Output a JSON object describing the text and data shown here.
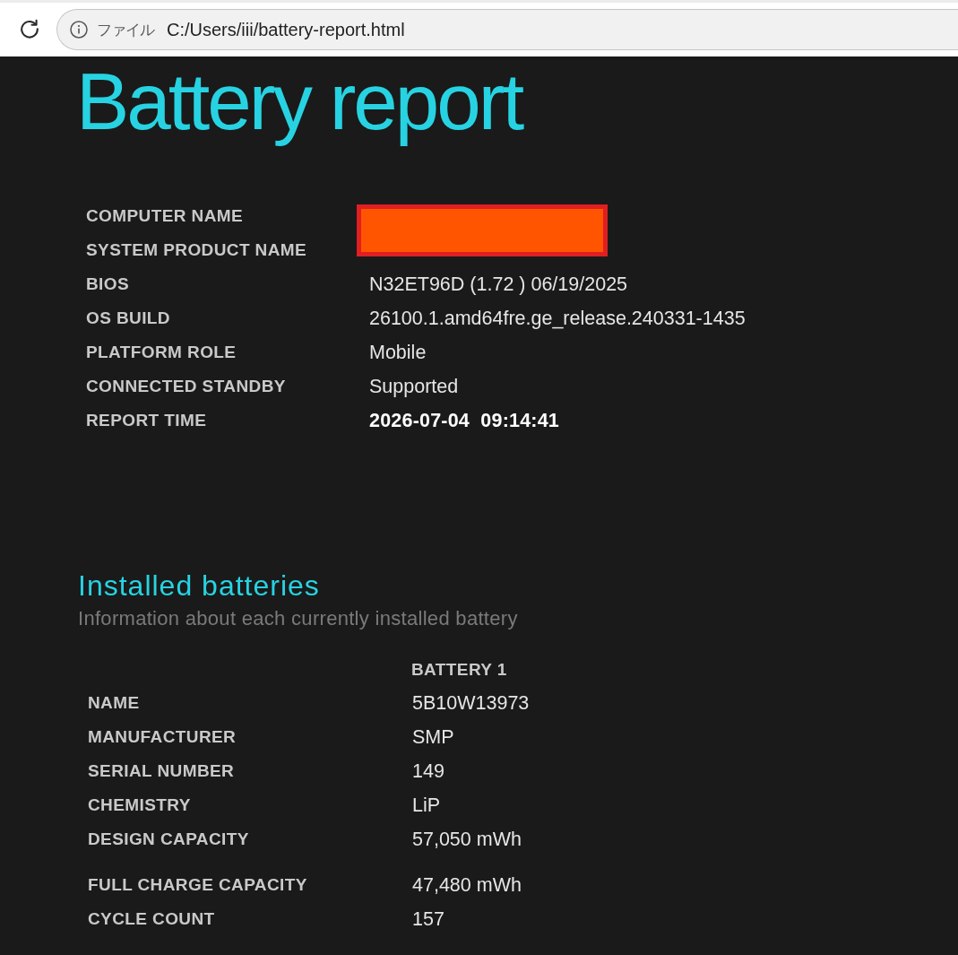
{
  "browser": {
    "scheme_label": "ファイル",
    "url": "C:/Users/iii/battery-report.html"
  },
  "report": {
    "title": "Battery report"
  },
  "system_info": {
    "rows": [
      {
        "label": "COMPUTER NAME",
        "redacted": true
      },
      {
        "label": "SYSTEM PRODUCT NAME",
        "redacted": true
      },
      {
        "label": "BIOS",
        "value": "N32ET96D (1.72 ) 06/19/2025",
        "kind": "text"
      },
      {
        "label": "OS BUILD",
        "value": "26100.1.amd64fre.ge_release.240331-1435",
        "kind": "text"
      },
      {
        "label": "PLATFORM ROLE",
        "value": "Mobile",
        "kind": "text"
      },
      {
        "label": "CONNECTED STANDBY",
        "value": "Supported",
        "kind": "text"
      },
      {
        "label": "REPORT TIME",
        "value": "2026-07-04  09:14:41",
        "kind": "timestamp"
      }
    ]
  },
  "installed_batteries": {
    "title": "Installed batteries",
    "subtitle": "Information about each currently installed battery",
    "column_header": "BATTERY 1",
    "row_groups": [
      [
        {
          "label": "NAME",
          "value": "5B10W13973"
        },
        {
          "label": "MANUFACTURER",
          "value": "SMP"
        },
        {
          "label": "SERIAL NUMBER",
          "value": "149"
        },
        {
          "label": "CHEMISTRY",
          "value": "LiP"
        },
        {
          "label": "DESIGN CAPACITY",
          "value": "57,050 mWh"
        }
      ],
      [
        {
          "label": "FULL CHARGE CAPACITY",
          "value": "47,480 mWh"
        },
        {
          "label": "CYCLE COUNT",
          "value": "157"
        }
      ]
    ]
  }
}
